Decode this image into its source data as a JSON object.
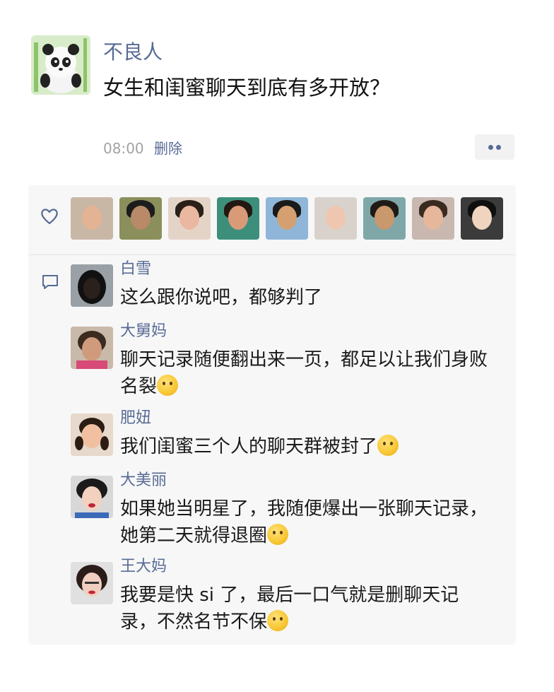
{
  "post": {
    "author": "不良人",
    "text": "女生和闺蜜聊天到底有多开放？",
    "time": "08:00",
    "delete_label": "删除"
  },
  "icons": {
    "more": "more-dots-icon",
    "like": "heart-icon",
    "comment": "comment-bubble-icon"
  },
  "colors": {
    "name_link": "#576b95",
    "panel_bg": "#f7f7f7",
    "meta_gray": "#a3a3a3"
  },
  "comments": [
    {
      "name": "白雪",
      "text": "这么跟你说吧，都够判了",
      "emoji": ""
    },
    {
      "name": "大舅妈",
      "text": "聊天记录随便翻出来一页，都足以让我们身败名裂",
      "emoji": "cry-laugh"
    },
    {
      "name": "肥妞",
      "text": "我们闺蜜三个人的聊天群被封了",
      "emoji": "dizzy"
    },
    {
      "name": "大美丽",
      "text": "如果她当明星了，我随便爆出一张聊天记录，她第二天就得退圈",
      "emoji": "smile"
    },
    {
      "name": "王大妈",
      "text": "我要是快 si 了，最后一口气就是删聊天记录，不然名节不保",
      "emoji": "crying"
    }
  ]
}
